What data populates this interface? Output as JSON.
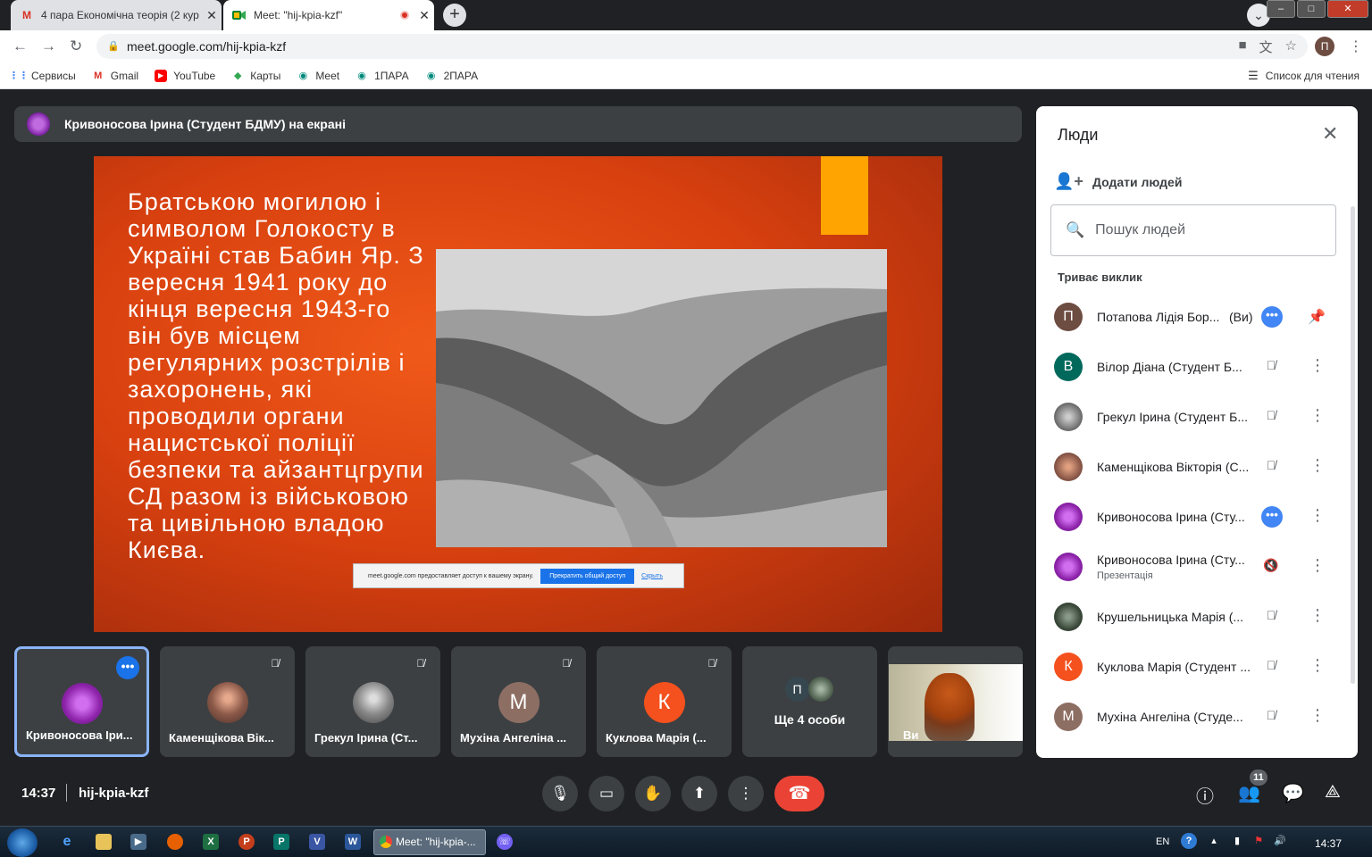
{
  "browser": {
    "tabs": [
      {
        "title": "4 пара Економічна теорія (2 кур",
        "favicon": "M"
      },
      {
        "title": "Meet: \"hij-kpia-kzf\"",
        "favicon": "meet"
      }
    ],
    "url": "meet.google.com/hij-kpia-kzf",
    "profile_initial": "П",
    "bookmarks": [
      "Сервисы",
      "Gmail",
      "YouTube",
      "Карты",
      "Meet",
      "1ПАРА",
      "2ПАРА"
    ],
    "reading_list": "Список для чтения"
  },
  "presenter_bar": {
    "text": "Кривоносова Ірина (Студент БДМУ) на екрані"
  },
  "slide": {
    "text": "Братською могилою і символом Голокосту в Україні став Бабин Яр. З вересня 1941 року до кінця вересня 1943-го він був місцем регулярних розстрілів і захоронень, які проводили органи нацистської поліції безпеки та айзантцгрупи СД разом із військовою та цивільною владою Києва.",
    "share_banner": {
      "message": "meet.google.com предоставляет доступ к вашему экрану.",
      "stop_button": "Прекратить общий доступ",
      "hide_link": "Скрыть"
    }
  },
  "tiles": [
    {
      "name": "Кривоносова Іри...",
      "initial": "",
      "color": "#7b1fa2"
    },
    {
      "name": "Каменщікова Вік...",
      "initial": "",
      "color": "#8d5a4a"
    },
    {
      "name": "Грекул Ірина (Ст...",
      "initial": "",
      "color": "#888888"
    },
    {
      "name": "Мухіна Ангеліна ...",
      "initial": "М",
      "color": "#8d6e63"
    },
    {
      "name": "Куклова Марія (...",
      "initial": "К",
      "color": "#f4511e"
    }
  ],
  "more_tile": {
    "label": "Ще 4 особи",
    "initial": "П"
  },
  "self_tile": {
    "label": "Ви"
  },
  "bottom": {
    "time": "14:37",
    "meeting_code": "hij-kpia-kzf",
    "people_count": "11"
  },
  "people_panel": {
    "title": "Люди",
    "add_people": "Додати людей",
    "search_placeholder": "Пошук людей",
    "section": "Триває виклик",
    "participants": [
      {
        "name": "Потапова Лідія Бор...",
        "suffix": "(Ви)",
        "initial": "П",
        "color": "#6d4c41",
        "sub": ""
      },
      {
        "name": "Вілор Діана (Студент Б...",
        "suffix": "",
        "initial": "В",
        "color": "#00695c",
        "sub": ""
      },
      {
        "name": "Грекул Ірина (Студент Б...",
        "suffix": "",
        "initial": "",
        "color": "#7a7a7a",
        "sub": ""
      },
      {
        "name": "Каменщікова Вікторія (С...",
        "suffix": "",
        "initial": "",
        "color": "#8d5a4a",
        "sub": ""
      },
      {
        "name": "Кривоносова Ірина (Сту...",
        "suffix": "",
        "initial": "",
        "color": "#8e24aa",
        "sub": ""
      },
      {
        "name": "Кривоносова Ірина (Сту...",
        "suffix": "",
        "initial": "",
        "color": "#8e24aa",
        "sub": "Презентація"
      },
      {
        "name": "Крушельницька Марія (...",
        "suffix": "",
        "initial": "",
        "color": "#3c3c3c",
        "sub": ""
      },
      {
        "name": "Куклова Марія (Студент ...",
        "suffix": "",
        "initial": "К",
        "color": "#f4511e",
        "sub": ""
      },
      {
        "name": "Мухіна Ангеліна (Студе...",
        "suffix": "",
        "initial": "М",
        "color": "#8d6e63",
        "sub": ""
      }
    ]
  },
  "taskbar": {
    "task_title": "Meet: \"hij-kpia-...",
    "language": "EN",
    "clock": "14:37"
  },
  "colors": {
    "meet_dark": "#202124",
    "tile": "#3c4043",
    "accent": "#1a73e8",
    "end_call": "#ea4335",
    "slide_orange": "#e8490f"
  }
}
